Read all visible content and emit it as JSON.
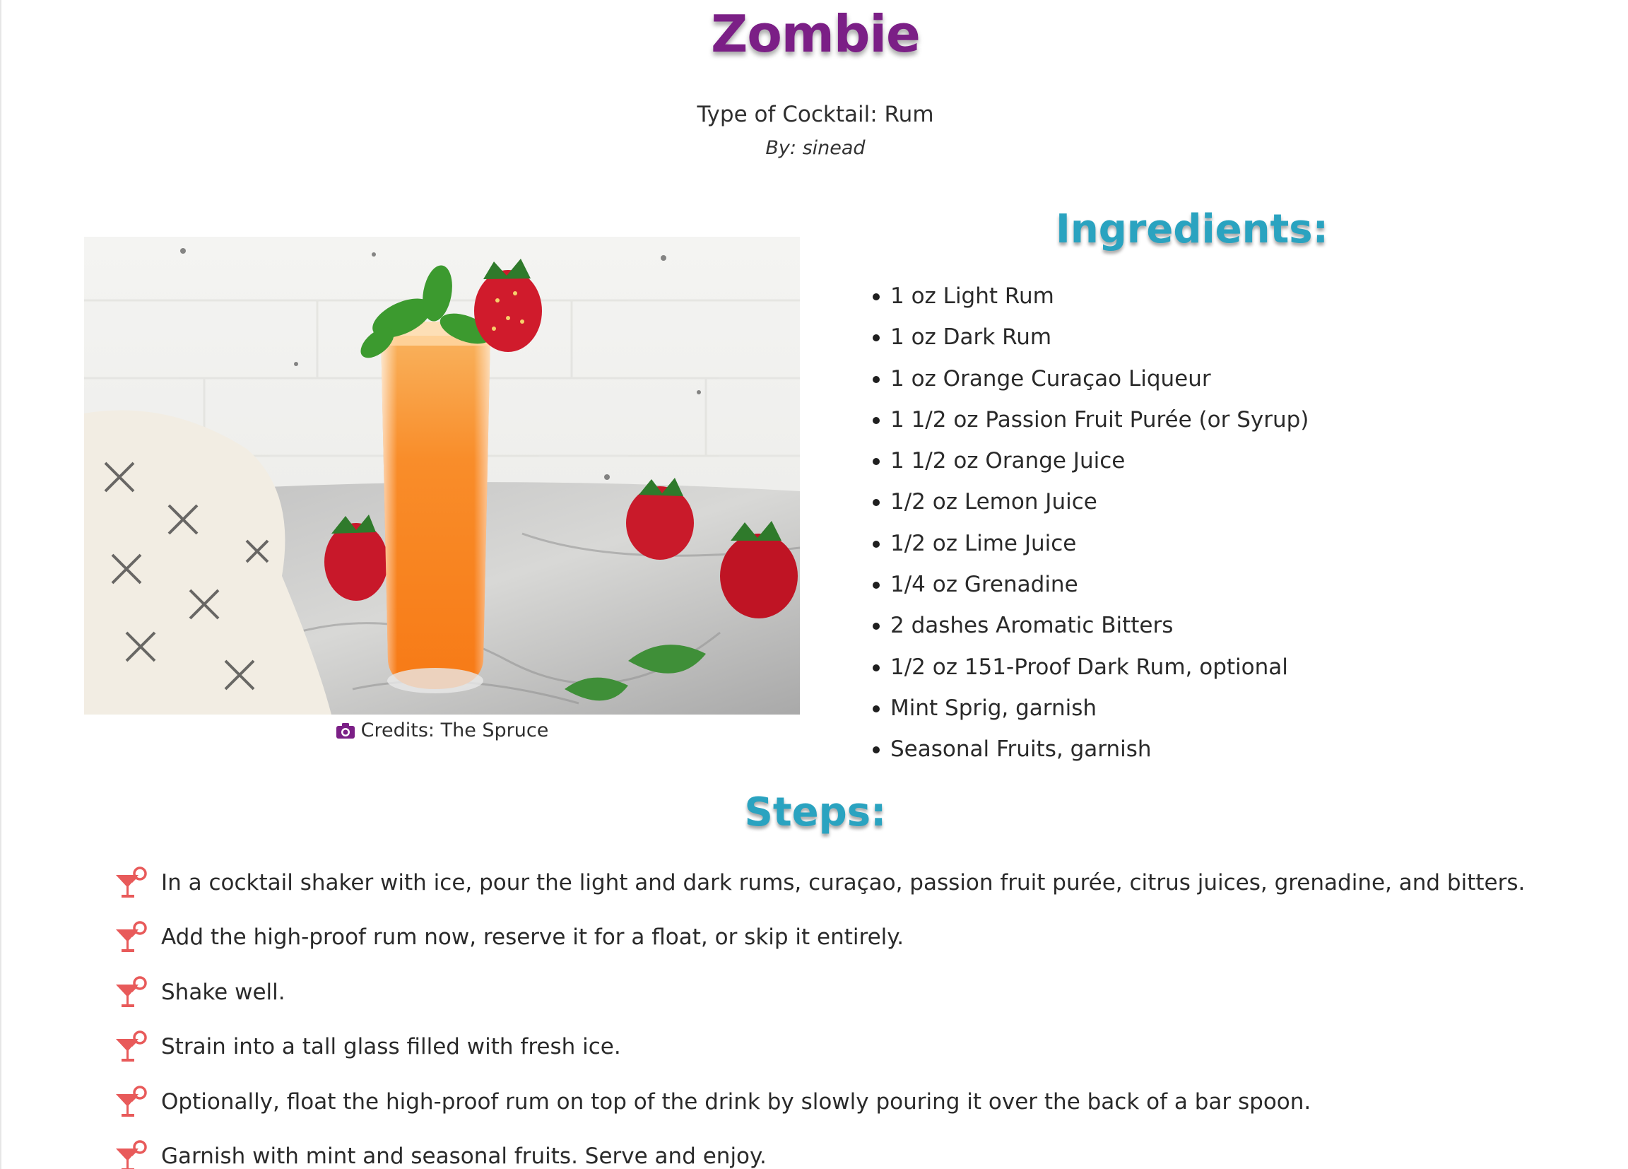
{
  "recipe": {
    "title": "Zombie",
    "type_line": "Type of Cocktail: Rum",
    "author_line": "By: sinead"
  },
  "photo": {
    "alt": "Zombie cocktail",
    "credits": "Credits: The Spruce",
    "credits_icon": "camera-icon"
  },
  "ingredients": {
    "heading": "Ingredients:",
    "items": [
      "1 oz Light Rum",
      "1 oz Dark Rum",
      "1 oz Orange Curaçao Liqueur",
      "1 1/2 oz Passion Fruit Purée (or Syrup)",
      "1 1/2 oz Orange Juice",
      "1/2 oz Lemon Juice",
      "1/2 oz Lime Juice",
      "1/4 oz Grenadine",
      "2 dashes Aromatic Bitters",
      "1/2 oz 151-Proof Dark Rum, optional",
      "Mint Sprig, garnish",
      "Seasonal Fruits, garnish"
    ]
  },
  "steps": {
    "heading": "Steps:",
    "icon": "cocktail-glass-icon",
    "items": [
      "In a cocktail shaker with ice, pour the light and dark rums, curaçao, passion fruit purée, citrus juices, grenadine, and bitters.",
      "Add the high-proof rum now, reserve it for a float, or skip it entirely.",
      "Shake well.",
      "Strain into a tall glass filled with fresh ice.",
      "Optionally, float the high-proof rum on top of the drink by slowly pouring it over the back of a bar spoon.",
      "Garnish with mint and seasonal fruits. Serve and enjoy."
    ]
  },
  "colors": {
    "title": "#7b1f86",
    "heading": "#2aa3c0",
    "step_icon": "#e85a5a",
    "camera_icon": "#7b1f86"
  }
}
